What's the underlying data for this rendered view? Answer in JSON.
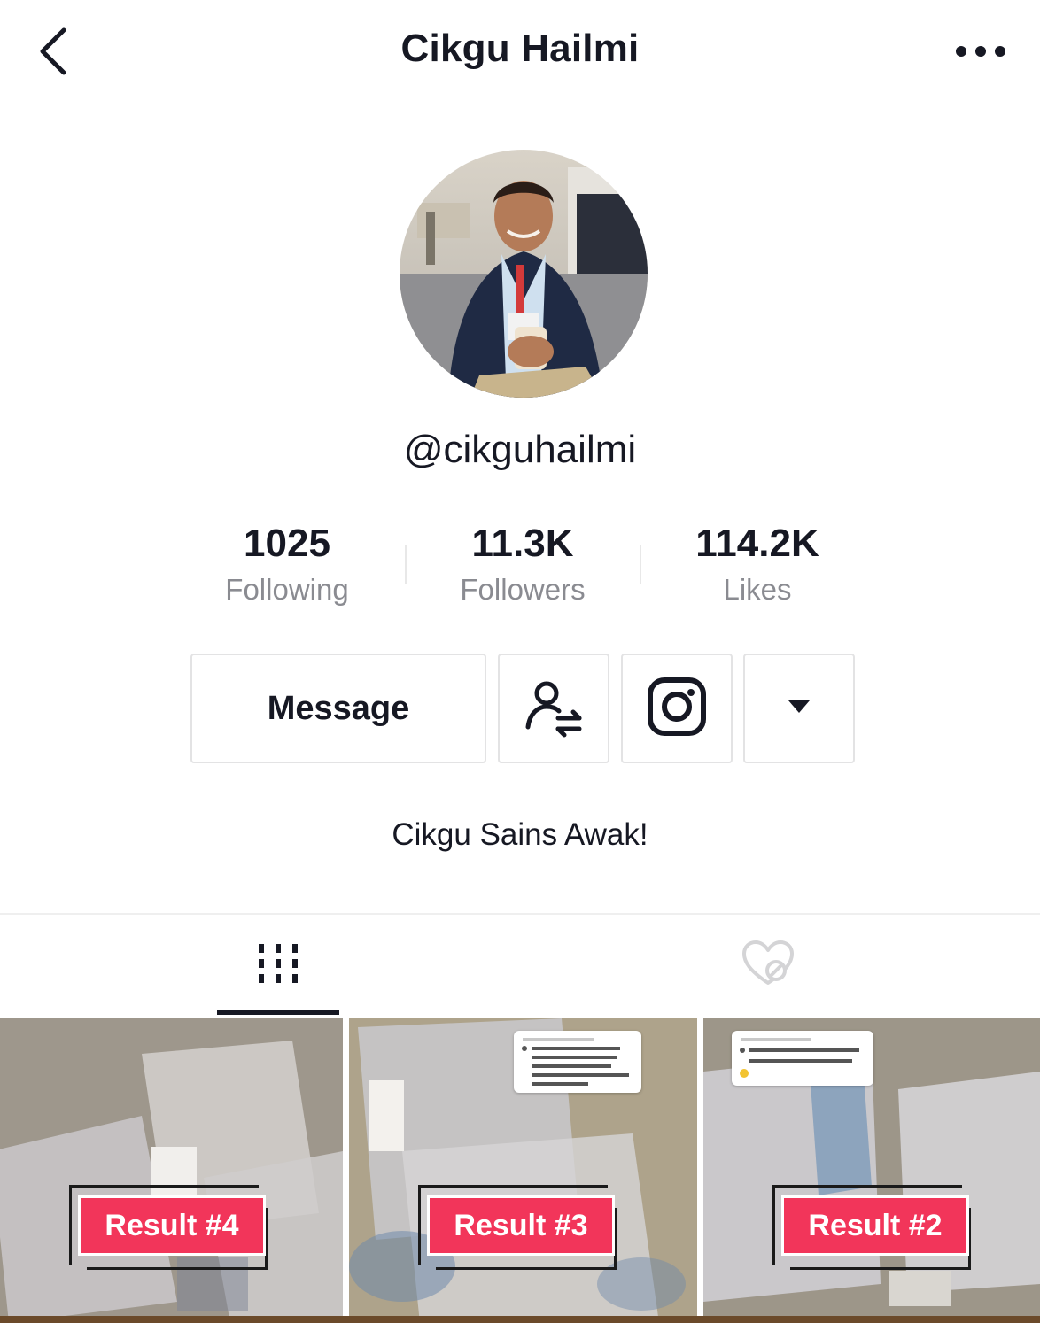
{
  "header": {
    "title": "Cikgu Hailmi",
    "back_icon": "chevron-left-icon",
    "more_icon": "more-horizontal-icon"
  },
  "profile": {
    "username": "@cikguhailmi",
    "bio": "Cikgu Sains Awak!"
  },
  "stats": {
    "following": {
      "value": "1025",
      "label": "Following"
    },
    "followers": {
      "value": "11.3K",
      "label": "Followers"
    },
    "likes": {
      "value": "114.2K",
      "label": "Likes"
    }
  },
  "actions": {
    "message_label": "Message",
    "follow_icon": "user-switch-icon",
    "instagram_icon": "instagram-icon",
    "dropdown_icon": "caret-down-icon"
  },
  "tabs": [
    {
      "name": "videos",
      "icon": "grid-icon",
      "active": true
    },
    {
      "name": "liked",
      "icon": "heart-hidden-icon",
      "active": false
    }
  ],
  "videos": [
    {
      "label": "Result #4"
    },
    {
      "label": "Result #3"
    },
    {
      "label": "Result #2"
    }
  ],
  "colors": {
    "accent": "#f2355a",
    "text": "#161823",
    "muted": "#8a8b91",
    "border": "#e3e3e4"
  }
}
